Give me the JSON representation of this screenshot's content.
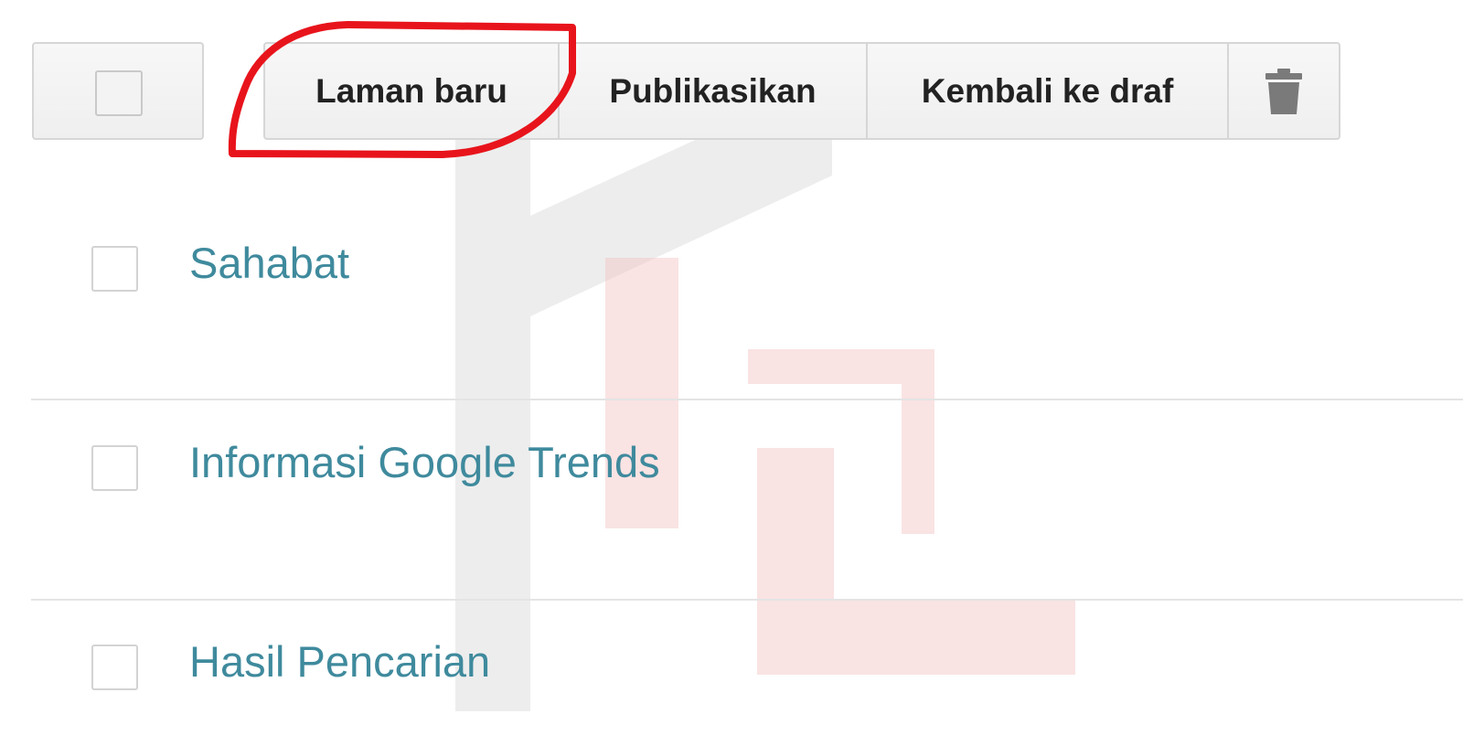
{
  "toolbar": {
    "buttons": [
      {
        "label": "Laman baru"
      },
      {
        "label": "Publikasikan"
      },
      {
        "label": "Kembali ke draf"
      }
    ],
    "delete_icon": "trash-icon"
  },
  "pages": [
    {
      "title": "Sahabat"
    },
    {
      "title": "Informasi Google Trends"
    },
    {
      "title": "Hasil Pencarian"
    }
  ],
  "colors": {
    "link": "#3f8a9d",
    "highlight": "#e8141c"
  }
}
